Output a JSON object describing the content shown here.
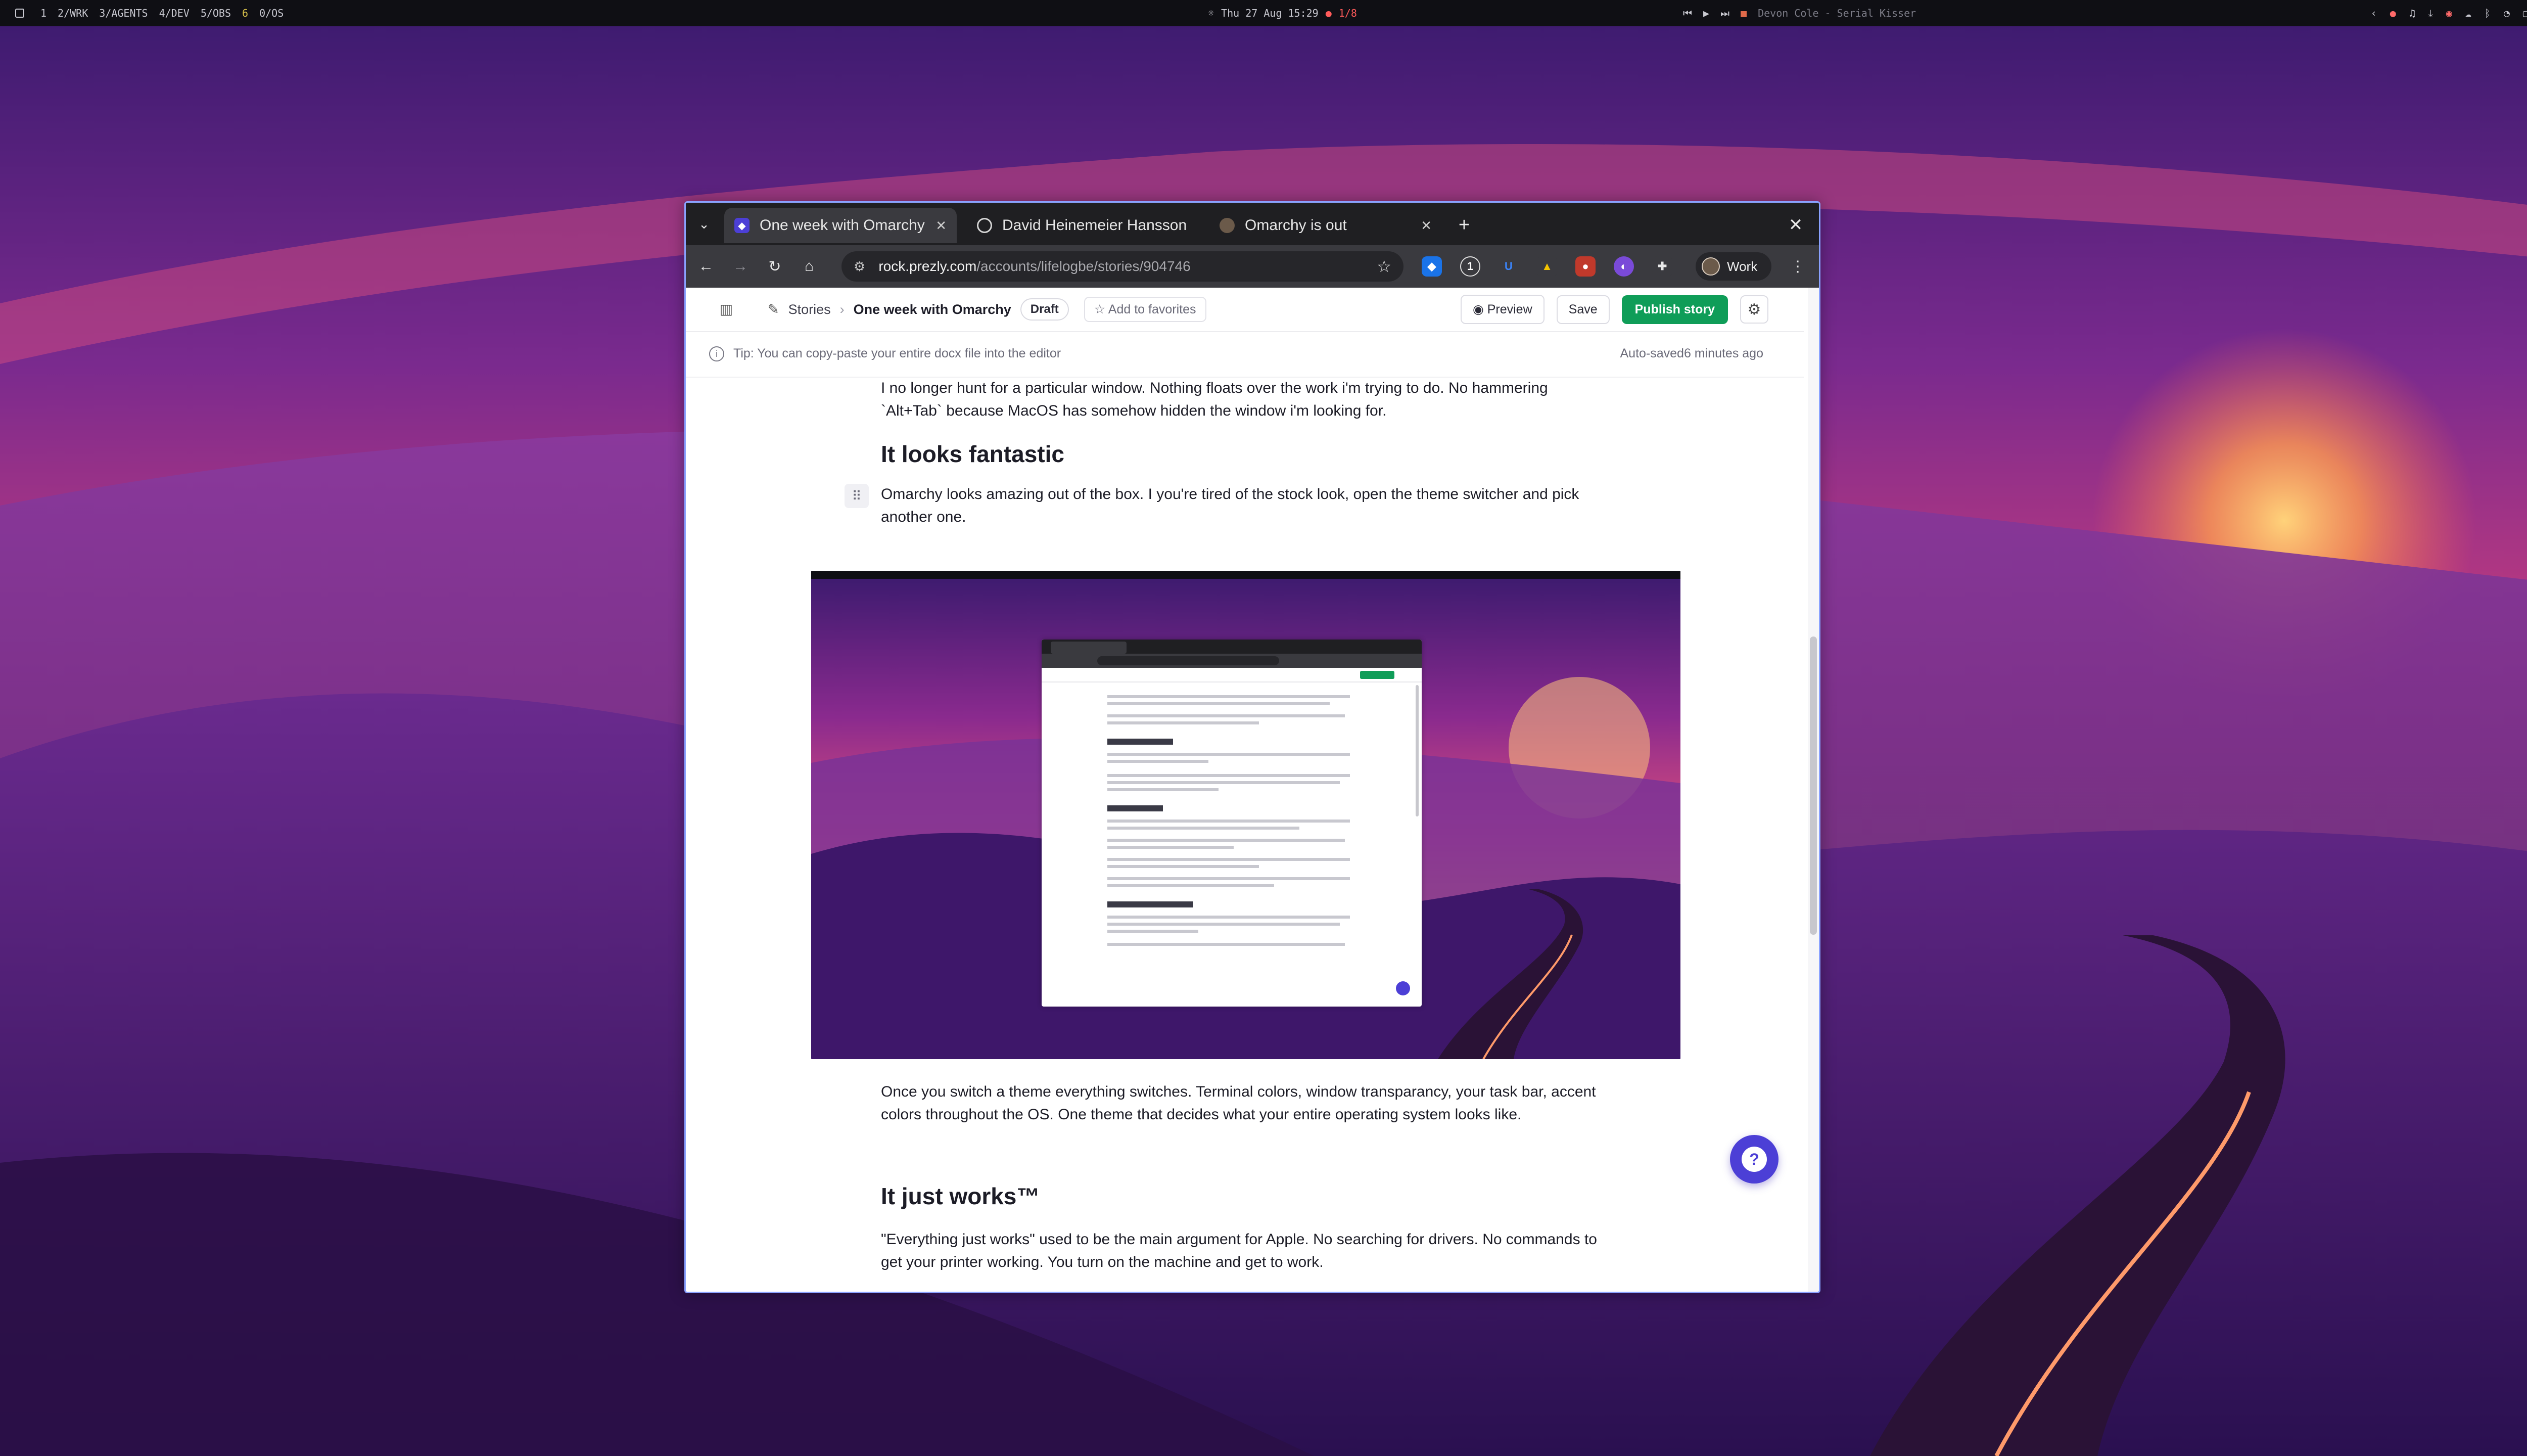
{
  "topbar": {
    "workspaces": [
      "1",
      "2/WRK",
      "3/AGENTS",
      "4/DEV",
      "5/OBS",
      "6",
      "0/OS"
    ],
    "active_workspace": "6",
    "clock": "Thu 27 Aug 15:29",
    "notifications": "1/8",
    "now_playing": "Devon Cole - Serial Kisser"
  },
  "browser": {
    "tabs": [
      {
        "title": "One week with Omarchy",
        "active": true
      },
      {
        "title": "David Heinemeier Hansson",
        "active": false
      },
      {
        "title": "Omarchy is out",
        "active": false
      }
    ],
    "url_domain": "rock.prezly.com",
    "url_path": "/accounts/lifelogbe/stories/904746",
    "profile_label": "Work"
  },
  "app": {
    "breadcrumb_root": "Stories",
    "breadcrumb_current": "One week with Omarchy",
    "status_badge": "Draft",
    "favorites_label": "Add to favorites",
    "preview_label": "Preview",
    "save_label": "Save",
    "publish_label": "Publish story",
    "tip": "Tip: You can copy-paste your entire docx file into the editor",
    "autosave": "Auto-saved6 minutes ago"
  },
  "article": {
    "p1": "I no longer hunt for a particular window. Nothing floats over the work i'm trying to do. No hammering `Alt+Tab` because MacOS has somehow hidden the window i'm looking for.",
    "h_looks": "It looks fantastic",
    "p2": "Omarchy looks amazing out of the box. I you're tired of the stock look, open the theme switcher and pick another one.",
    "p3": "Once you switch a theme everything switches. Terminal colors, window transparancy, your task bar, accent colors throughout the OS. One theme that decides what your entire operating system looks like.",
    "h_works": "It just works™",
    "p4": "\"Everything just works\" used to be the main argument for Apple. No searching for drivers. No commands to get your printer working. You turn on the machine and get to work."
  },
  "colors": {
    "accent": "#4c3fd6",
    "publish": "#0f9d58",
    "window_border": "#8aa2ff"
  },
  "icons": {
    "help": "help-chat-icon",
    "settings": "gear-icon",
    "star": "star-icon"
  }
}
